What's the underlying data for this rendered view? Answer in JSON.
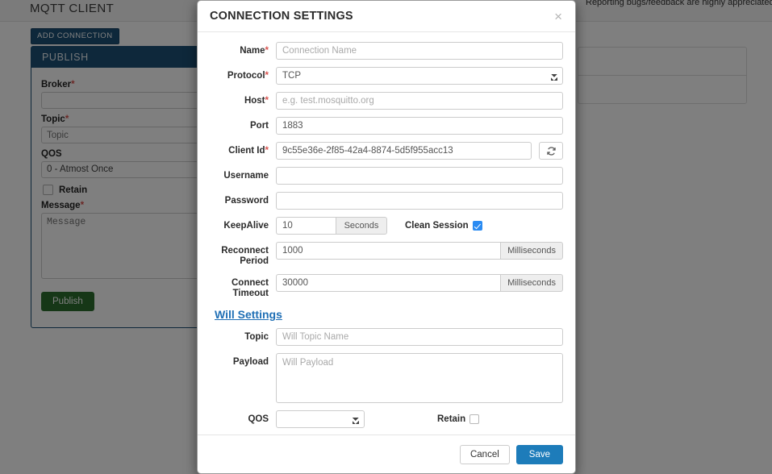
{
  "background": {
    "app_title": "MQTT CLIENT",
    "feedback_note": "Reporting bugs/feedback are highly appreciated.",
    "add_connection_label": "ADD CONNECTION",
    "publish_panel": {
      "header": "PUBLISH",
      "broker_label": "Broker",
      "broker_required": "*",
      "broker_value": "",
      "topic_label": "Topic",
      "topic_required": "*",
      "topic_placeholder": "Topic",
      "qos_label": "QOS",
      "qos_value": "0 - Atmost Once",
      "retain_label": "Retain",
      "message_label": "Message",
      "message_required": "*",
      "message_placeholder": "Message",
      "publish_button": "Publish"
    }
  },
  "modal": {
    "title": "CONNECTION SETTINGS",
    "close_icon": "×",
    "fields": {
      "name_label": "Name",
      "name_required": "*",
      "name_placeholder": "Connection Name",
      "name_value": "",
      "protocol_label": "Protocol",
      "protocol_required": "*",
      "protocol_value": "TCP",
      "host_label": "Host",
      "host_required": "*",
      "host_placeholder": "e.g. test.mosquitto.org",
      "host_value": "",
      "port_label": "Port",
      "port_value": "1883",
      "client_id_label": "Client Id",
      "client_id_required": "*",
      "client_id_value": "9c55e36e-2f85-42a4-8874-5d5f955acc13",
      "client_id_refresh_icon": "refresh-icon",
      "username_label": "Username",
      "username_value": "",
      "password_label": "Password",
      "password_value": "",
      "keepalive_label": "KeepAlive",
      "keepalive_value": "10",
      "keepalive_unit": "Seconds",
      "clean_session_label": "Clean Session",
      "clean_session_checked": true,
      "reconnect_period_label": "Reconnect Period",
      "reconnect_period_value": "1000",
      "reconnect_period_unit": "Milliseconds",
      "connect_timeout_label": "Connect Timeout",
      "connect_timeout_value": "30000",
      "connect_timeout_unit": "Milliseconds"
    },
    "will_settings": {
      "section_link": "Will Settings",
      "topic_label": "Topic",
      "topic_placeholder": "Will Topic Name",
      "topic_value": "",
      "payload_label": "Payload",
      "payload_placeholder": "Will Payload",
      "payload_value": "",
      "qos_label": "QOS",
      "qos_value": "",
      "retain_label": "Retain",
      "retain_checked": false
    },
    "footer": {
      "cancel_label": "Cancel",
      "save_label": "Save"
    }
  },
  "colors": {
    "brand_dark_blue": "#1c5077",
    "primary_blue": "#1d7cba",
    "link_blue": "#1f6fb5",
    "publish_green": "#2c6e2f",
    "required_red": "#d9534f",
    "checkbox_blue": "#2a8bf2"
  }
}
